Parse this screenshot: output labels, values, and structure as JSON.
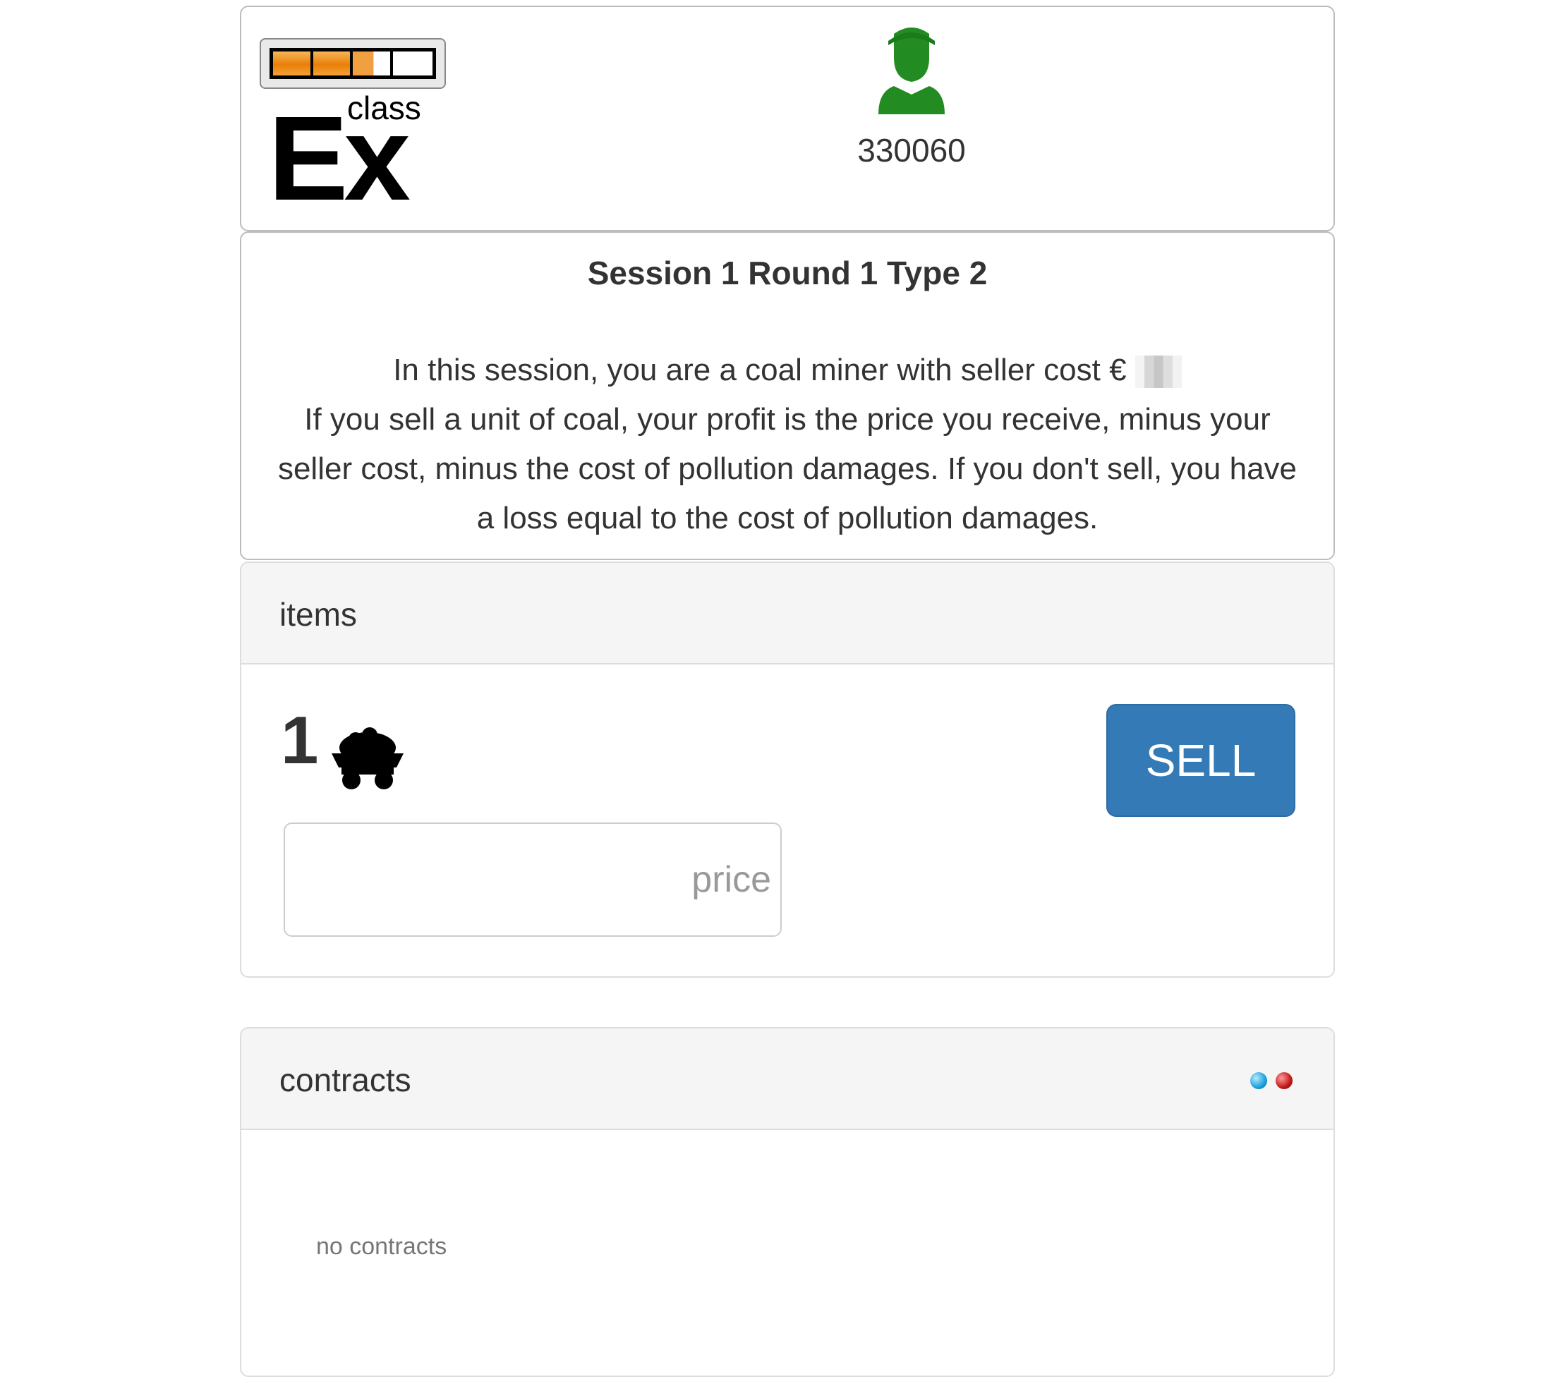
{
  "header": {
    "logo": {
      "small_text": "class",
      "big_text": "Ex",
      "progress_fraction": 0.625
    },
    "participant": {
      "icon": "person-icon",
      "id": "330060",
      "icon_color": "#228b22"
    }
  },
  "intro": {
    "title": "Session 1 Round 1 Type 2",
    "line1": "In this session, you are a coal miner with seller cost €",
    "paragraph": "If you sell a unit of coal, your profit is the price you receive, minus your seller cost, minus the cost of pollution damages. If you don't sell, you have a loss equal to the cost of pollution damages."
  },
  "items_panel": {
    "title": "items",
    "count": "1",
    "item_icon": "coal-cart-icon",
    "sell_label": "SELL",
    "price_input": {
      "value": "",
      "placeholder": "price"
    },
    "currency": "€"
  },
  "contracts_panel": {
    "title": "contracts",
    "status_icons": [
      "blue-dot-icon",
      "red-dot-icon"
    ],
    "empty_text": "no contracts"
  },
  "colors": {
    "primary_button": "#337ab7",
    "panel_heading_bg": "#f5f5f5",
    "progress": "#e97f07"
  }
}
